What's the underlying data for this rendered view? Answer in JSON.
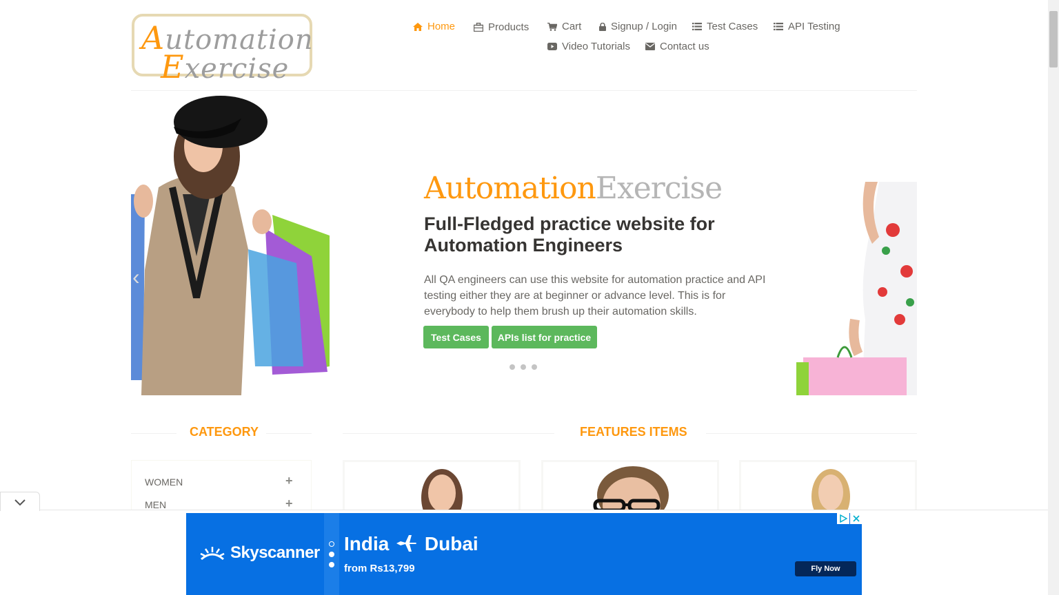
{
  "header": {
    "logo": {
      "line1_initial": "A",
      "line1_rest": "utomation",
      "line2_initial": "E",
      "line2_rest": "xercise"
    },
    "nav": [
      {
        "label": "Home",
        "icon": "home-icon",
        "active": true
      },
      {
        "label": "Products",
        "icon": "products-icon"
      },
      {
        "label": "Cart",
        "icon": "cart-icon"
      },
      {
        "label": "Signup / Login",
        "icon": "lock-icon"
      },
      {
        "label": "Test Cases",
        "icon": "list-icon"
      },
      {
        "label": "API Testing",
        "icon": "list-icon"
      },
      {
        "label": "Video Tutorials",
        "icon": "youtube-icon"
      },
      {
        "label": "Contact us",
        "icon": "envelope-icon"
      }
    ]
  },
  "slider": {
    "brand_a": "Automation",
    "brand_b": "Exercise",
    "headline": "Full-Fledged practice website for Automation Engineers",
    "description": "All QA engineers can use this website for automation practice and API testing either they are at beginner or advance level. This is for everybody to help them brush up their automation skills.",
    "buttons": [
      "Test Cases",
      "APIs list for practice"
    ],
    "indicator_count": 3
  },
  "category": {
    "title": "Category",
    "items": [
      {
        "label": "Women"
      },
      {
        "label": "Men"
      }
    ]
  },
  "features": {
    "title": "Features Items"
  },
  "ad": {
    "brand": "Skyscanner",
    "route_from": "India",
    "route_to": "Dubai",
    "price": "from Rs13,799",
    "cta": "Fly Now"
  },
  "colors": {
    "accent": "#fe980f",
    "nav_text": "#696763",
    "button_green": "#5cb85c",
    "ad_blue": "#0770e3",
    "ad_cta": "#042759"
  }
}
